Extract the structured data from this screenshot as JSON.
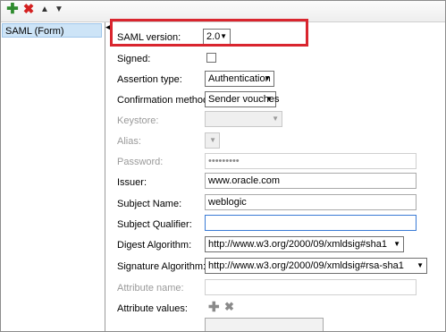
{
  "toolbar": {
    "add_icon": "plus-icon",
    "remove_icon": "x-icon",
    "up_icon": "chevron-up-icon",
    "down_icon": "chevron-down-icon"
  },
  "list": {
    "items": [
      {
        "label": "SAML (Form)"
      }
    ]
  },
  "form": {
    "saml_version_label": "SAML version:",
    "saml_version_value": "2.0",
    "signed_label": "Signed:",
    "assertion_type_label": "Assertion type:",
    "assertion_type_value": "Authentication",
    "confirmation_method_label": "Confirmation method:",
    "confirmation_method_value": "Sender vouches",
    "keystore_label": "Keystore:",
    "alias_label": "Alias:",
    "password_label": "Password:",
    "password_value": "•••••••••",
    "issuer_label": "Issuer:",
    "issuer_value": "www.oracle.com",
    "subject_name_label": "Subject Name:",
    "subject_name_value": "weblogic",
    "subject_qualifier_label": "Subject Qualifier:",
    "subject_qualifier_value": "",
    "digest_algorithm_label": "Digest Algorithm:",
    "digest_algorithm_value": "http://www.w3.org/2000/09/xmldsig#sha1",
    "signature_algorithm_label": "Signature Algorithm:",
    "signature_algorithm_value": "http://www.w3.org/2000/09/xmldsig#rsa-sha1",
    "attribute_name_label": "Attribute name:",
    "attribute_name_value": "",
    "attribute_values_label": "Attribute values:"
  },
  "colors": {
    "highlight": "#d9252e",
    "selection": "#cde4f7"
  }
}
